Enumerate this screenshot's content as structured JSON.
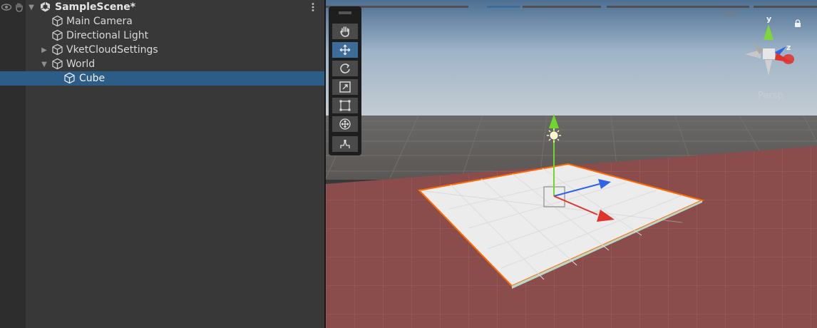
{
  "hierarchy": {
    "scene_name": "SampleScene*",
    "items": [
      {
        "label": "Main Camera",
        "has_children": false,
        "expanded": false,
        "selected": false
      },
      {
        "label": "Directional Light",
        "has_children": false,
        "expanded": false,
        "selected": false
      },
      {
        "label": "VketCloudSettings",
        "has_children": true,
        "expanded": false,
        "selected": false
      },
      {
        "label": "World",
        "has_children": true,
        "expanded": true,
        "selected": false
      },
      {
        "label": "Cube",
        "has_children": false,
        "expanded": false,
        "selected": true
      }
    ]
  },
  "scene_view": {
    "camera_mode": "Persp",
    "tools": [
      {
        "name": "hand-tool",
        "active": false
      },
      {
        "name": "move-tool",
        "active": true
      },
      {
        "name": "rotate-tool",
        "active": false
      },
      {
        "name": "scale-tool",
        "active": false
      },
      {
        "name": "rect-tool",
        "active": false
      },
      {
        "name": "transform-tool",
        "active": false
      },
      {
        "name": "custom-tool",
        "active": false
      }
    ],
    "gizmo_axes": [
      "y",
      "z"
    ]
  },
  "colors": {
    "selection": "#2c5d87",
    "active_tool": "#3c6c9a",
    "panel_bg": "#383838",
    "axis_x": "#e0332b",
    "axis_y": "#6fd62a",
    "axis_z": "#2f63e8",
    "selection_outline": "#ff6a00"
  }
}
